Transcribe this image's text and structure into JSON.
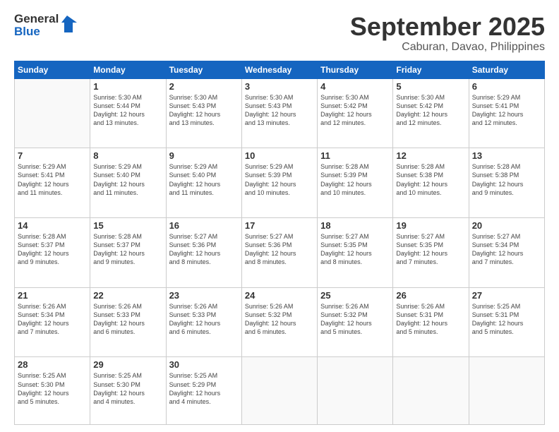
{
  "logo": {
    "line1": "General",
    "line2": "Blue"
  },
  "title": "September 2025",
  "location": "Caburan, Davao, Philippines",
  "days_header": [
    "Sunday",
    "Monday",
    "Tuesday",
    "Wednesday",
    "Thursday",
    "Friday",
    "Saturday"
  ],
  "weeks": [
    [
      {
        "day": "",
        "info": ""
      },
      {
        "day": "1",
        "info": "Sunrise: 5:30 AM\nSunset: 5:44 PM\nDaylight: 12 hours\nand 13 minutes."
      },
      {
        "day": "2",
        "info": "Sunrise: 5:30 AM\nSunset: 5:43 PM\nDaylight: 12 hours\nand 13 minutes."
      },
      {
        "day": "3",
        "info": "Sunrise: 5:30 AM\nSunset: 5:43 PM\nDaylight: 12 hours\nand 13 minutes."
      },
      {
        "day": "4",
        "info": "Sunrise: 5:30 AM\nSunset: 5:42 PM\nDaylight: 12 hours\nand 12 minutes."
      },
      {
        "day": "5",
        "info": "Sunrise: 5:30 AM\nSunset: 5:42 PM\nDaylight: 12 hours\nand 12 minutes."
      },
      {
        "day": "6",
        "info": "Sunrise: 5:29 AM\nSunset: 5:41 PM\nDaylight: 12 hours\nand 12 minutes."
      }
    ],
    [
      {
        "day": "7",
        "info": "Sunrise: 5:29 AM\nSunset: 5:41 PM\nDaylight: 12 hours\nand 11 minutes."
      },
      {
        "day": "8",
        "info": "Sunrise: 5:29 AM\nSunset: 5:40 PM\nDaylight: 12 hours\nand 11 minutes."
      },
      {
        "day": "9",
        "info": "Sunrise: 5:29 AM\nSunset: 5:40 PM\nDaylight: 12 hours\nand 11 minutes."
      },
      {
        "day": "10",
        "info": "Sunrise: 5:29 AM\nSunset: 5:39 PM\nDaylight: 12 hours\nand 10 minutes."
      },
      {
        "day": "11",
        "info": "Sunrise: 5:28 AM\nSunset: 5:39 PM\nDaylight: 12 hours\nand 10 minutes."
      },
      {
        "day": "12",
        "info": "Sunrise: 5:28 AM\nSunset: 5:38 PM\nDaylight: 12 hours\nand 10 minutes."
      },
      {
        "day": "13",
        "info": "Sunrise: 5:28 AM\nSunset: 5:38 PM\nDaylight: 12 hours\nand 9 minutes."
      }
    ],
    [
      {
        "day": "14",
        "info": "Sunrise: 5:28 AM\nSunset: 5:37 PM\nDaylight: 12 hours\nand 9 minutes."
      },
      {
        "day": "15",
        "info": "Sunrise: 5:28 AM\nSunset: 5:37 PM\nDaylight: 12 hours\nand 9 minutes."
      },
      {
        "day": "16",
        "info": "Sunrise: 5:27 AM\nSunset: 5:36 PM\nDaylight: 12 hours\nand 8 minutes."
      },
      {
        "day": "17",
        "info": "Sunrise: 5:27 AM\nSunset: 5:36 PM\nDaylight: 12 hours\nand 8 minutes."
      },
      {
        "day": "18",
        "info": "Sunrise: 5:27 AM\nSunset: 5:35 PM\nDaylight: 12 hours\nand 8 minutes."
      },
      {
        "day": "19",
        "info": "Sunrise: 5:27 AM\nSunset: 5:35 PM\nDaylight: 12 hours\nand 7 minutes."
      },
      {
        "day": "20",
        "info": "Sunrise: 5:27 AM\nSunset: 5:34 PM\nDaylight: 12 hours\nand 7 minutes."
      }
    ],
    [
      {
        "day": "21",
        "info": "Sunrise: 5:26 AM\nSunset: 5:34 PM\nDaylight: 12 hours\nand 7 minutes."
      },
      {
        "day": "22",
        "info": "Sunrise: 5:26 AM\nSunset: 5:33 PM\nDaylight: 12 hours\nand 6 minutes."
      },
      {
        "day": "23",
        "info": "Sunrise: 5:26 AM\nSunset: 5:33 PM\nDaylight: 12 hours\nand 6 minutes."
      },
      {
        "day": "24",
        "info": "Sunrise: 5:26 AM\nSunset: 5:32 PM\nDaylight: 12 hours\nand 6 minutes."
      },
      {
        "day": "25",
        "info": "Sunrise: 5:26 AM\nSunset: 5:32 PM\nDaylight: 12 hours\nand 5 minutes."
      },
      {
        "day": "26",
        "info": "Sunrise: 5:26 AM\nSunset: 5:31 PM\nDaylight: 12 hours\nand 5 minutes."
      },
      {
        "day": "27",
        "info": "Sunrise: 5:25 AM\nSunset: 5:31 PM\nDaylight: 12 hours\nand 5 minutes."
      }
    ],
    [
      {
        "day": "28",
        "info": "Sunrise: 5:25 AM\nSunset: 5:30 PM\nDaylight: 12 hours\nand 5 minutes."
      },
      {
        "day": "29",
        "info": "Sunrise: 5:25 AM\nSunset: 5:30 PM\nDaylight: 12 hours\nand 4 minutes."
      },
      {
        "day": "30",
        "info": "Sunrise: 5:25 AM\nSunset: 5:29 PM\nDaylight: 12 hours\nand 4 minutes."
      },
      {
        "day": "",
        "info": ""
      },
      {
        "day": "",
        "info": ""
      },
      {
        "day": "",
        "info": ""
      },
      {
        "day": "",
        "info": ""
      }
    ]
  ]
}
